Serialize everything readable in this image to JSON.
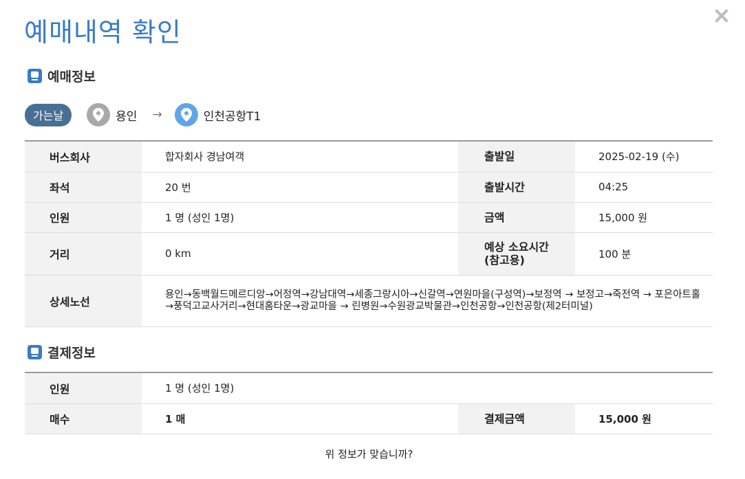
{
  "title": "예매내역 확인",
  "reservation": {
    "heading": "예매정보",
    "direction_label": "가는날",
    "origin": "용인",
    "arrow": "→",
    "destination": "인천공항T1",
    "rows": {
      "company_label": "버스회사",
      "company_value": "합자회사 경남여객",
      "date_label": "출발일",
      "date_value": "2025-02-19 (수)",
      "seat_label": "좌석",
      "seat_value": "20 번",
      "time_label": "출발시간",
      "time_value": "04:25",
      "people_label": "인원",
      "people_value": "1 명 (성인 1명)",
      "price_label": "금액",
      "price_value": "15,000 원",
      "distance_label": "거리",
      "distance_value": "0 km",
      "duration_label": "예상 소요시간\n(참고용)",
      "duration_value": "100 분",
      "route_label": "상세노선",
      "route_value": "용인→동백월드메르디앙→어정역→강남대역→세종그랑시아→신갈역→연원마을(구성역)→보정역 → 보정고→죽전역 → 포은아트홀→풍덕고교사거리→현대홈타운→광교마을 → 린병원→수원광교박물관→인천공항→인천공항(제2터미널)"
    }
  },
  "payment": {
    "heading": "결제정보",
    "people_label": "인원",
    "people_value": "1 명 (성인 1명)",
    "count_label": "매수",
    "count_value": "1 매",
    "amount_label": "결제금액",
    "amount_value": "15,000 원"
  },
  "confirm_text": "위 정보가 맞습니까?",
  "colors": {
    "accent": "#3a7bc8",
    "pill": "#4a6f95",
    "pin_origin": "#a9a9a9",
    "pin_destination": "#5ea6e6"
  }
}
